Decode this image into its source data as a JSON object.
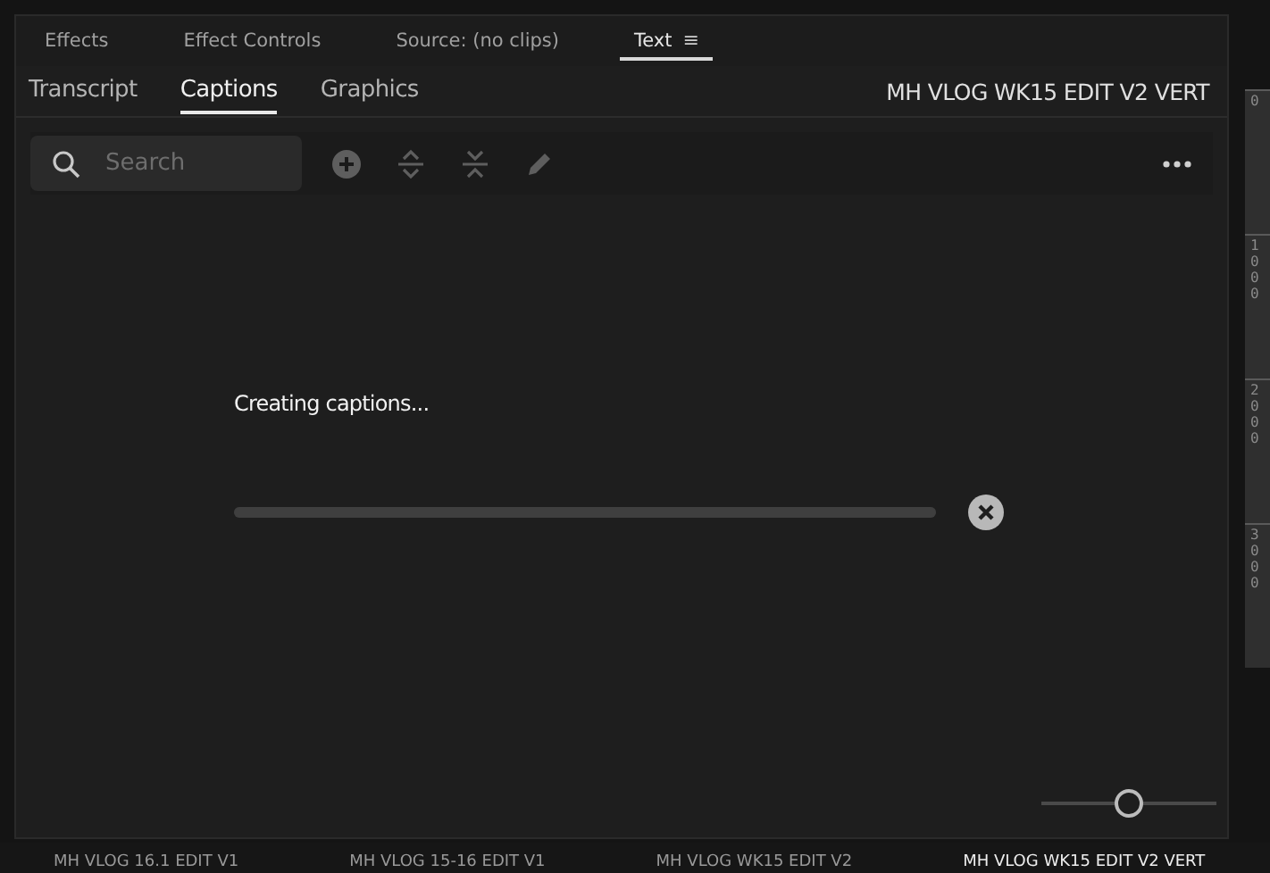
{
  "panel_tabs": [
    {
      "label": "Effects",
      "selected": false
    },
    {
      "label": "Effect Controls",
      "selected": false
    },
    {
      "label": "Source: (no clips)",
      "selected": false
    },
    {
      "label": "Text",
      "selected": true,
      "menu_icon": "≡"
    }
  ],
  "sub_tabs": [
    {
      "label": "Transcript",
      "selected": false
    },
    {
      "label": "Captions",
      "selected": true
    },
    {
      "label": "Graphics",
      "selected": false
    }
  ],
  "sequence_name": "MH VLOG WK15 EDIT V2 VERT",
  "search": {
    "placeholder": "Search"
  },
  "status": {
    "message": "Creating captions...",
    "level": 1
  },
  "zoom_slider": {
    "level": 0.5
  },
  "ruler": {
    "labels": [
      "0",
      "1000",
      "2000",
      "3000"
    ]
  },
  "sequence_tabs": [
    {
      "label": "MH VLOG 16.1 EDIT V1",
      "selected": false
    },
    {
      "label": "MH VLOG 15-16 EDIT V1",
      "selected": false
    },
    {
      "label": "MH VLOG WK15 EDIT V2",
      "selected": false
    },
    {
      "label": "MH VLOG WK15 EDIT V2 VERT",
      "selected": true
    }
  ]
}
